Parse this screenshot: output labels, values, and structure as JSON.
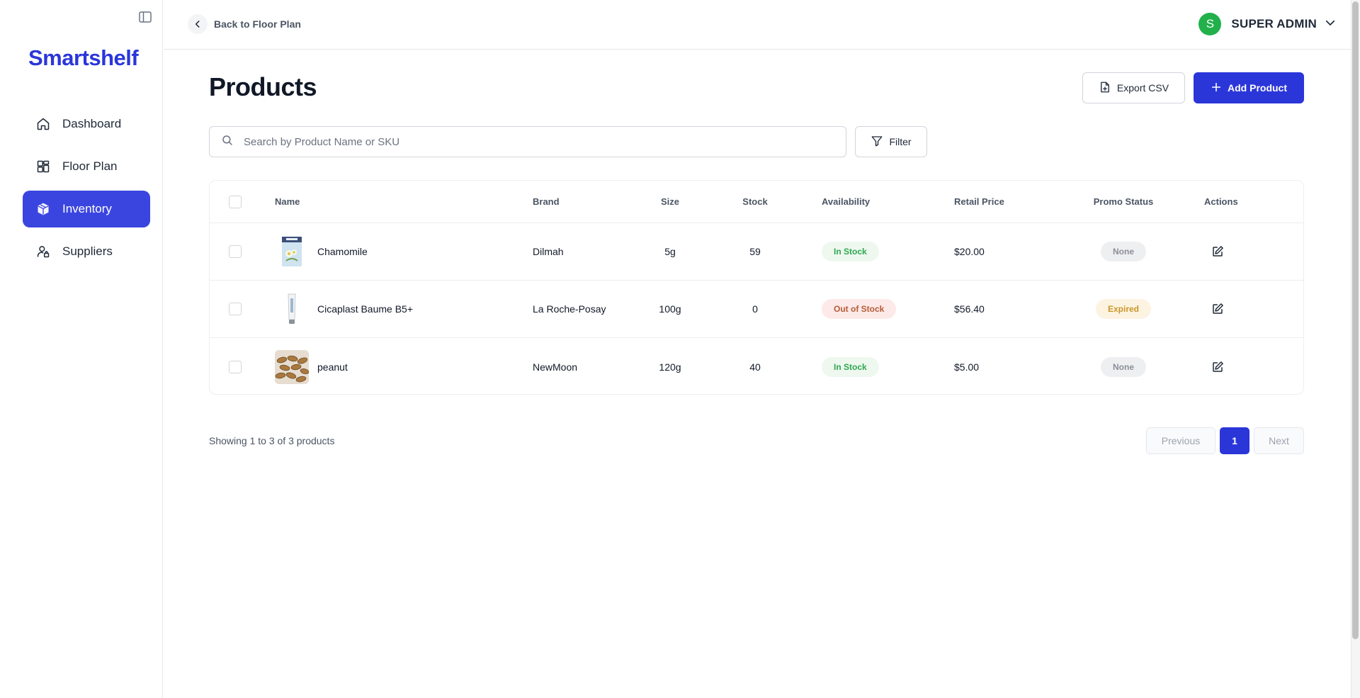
{
  "brand": "Smartshelf",
  "sidebar": {
    "items": [
      {
        "label": "Dashboard",
        "icon": "home-icon",
        "active": false
      },
      {
        "label": "Floor Plan",
        "icon": "floor-plan-icon",
        "active": false
      },
      {
        "label": "Inventory",
        "icon": "inventory-box-icon",
        "active": true
      },
      {
        "label": "Suppliers",
        "icon": "suppliers-user-icon",
        "active": false
      }
    ]
  },
  "topbar": {
    "back_label": "Back to Floor Plan",
    "user_initial": "S",
    "user_name": "SUPER ADMIN"
  },
  "page": {
    "title": "Products",
    "export_label": "Export CSV",
    "add_label": "Add Product",
    "search_placeholder": "Search by Product Name or SKU",
    "filter_label": "Filter"
  },
  "table": {
    "headers": {
      "name": "Name",
      "brand": "Brand",
      "size": "Size",
      "stock": "Stock",
      "availability": "Availability",
      "price": "Retail Price",
      "promo": "Promo Status",
      "actions": "Actions"
    },
    "rows": [
      {
        "name": "Chamomile",
        "brand": "Dilmah",
        "size": "5g",
        "stock": "59",
        "availability": "In Stock",
        "price": "$20.00",
        "promo": "None",
        "thumb": "tea-box"
      },
      {
        "name": "Cicaplast Baume B5+",
        "brand": "La Roche-Posay",
        "size": "100g",
        "stock": "0",
        "availability": "Out of Stock",
        "price": "$56.40",
        "promo": "Expired",
        "thumb": "cream-tube"
      },
      {
        "name": "peanut",
        "brand": "NewMoon",
        "size": "120g",
        "stock": "40",
        "availability": "In Stock",
        "price": "$5.00",
        "promo": "None",
        "thumb": "peanuts"
      }
    ]
  },
  "footer": {
    "showing": "Showing 1 to 3 of 3 products",
    "prev_label": "Previous",
    "current_page": "1",
    "next_label": "Next"
  },
  "colors": {
    "accent": "#2b36d9",
    "in_stock": "#2fa84f",
    "out_of_stock": "#b45d3a",
    "expired": "#c8972a",
    "avatar": "#22b04b"
  }
}
